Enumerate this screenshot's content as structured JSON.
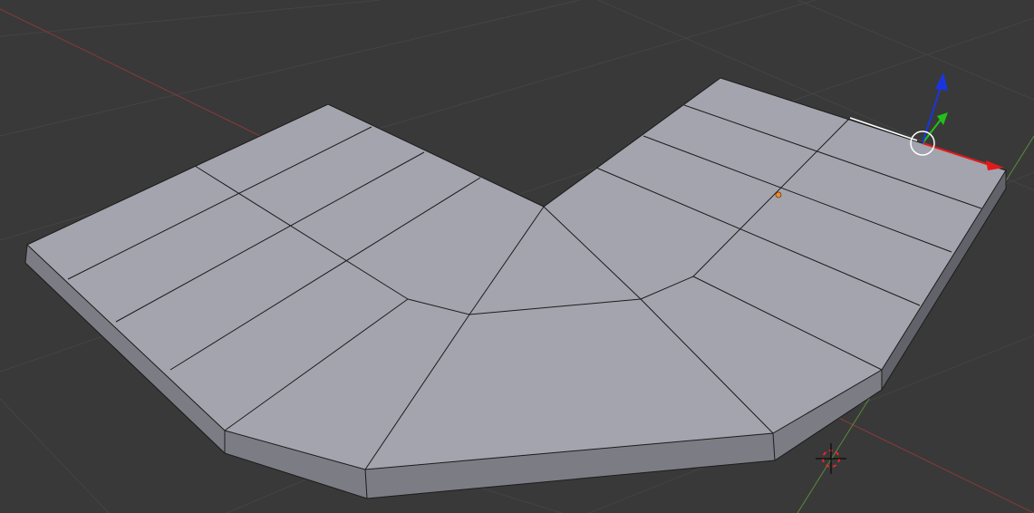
{
  "viewport": {
    "background": "#393939",
    "grid_color": "#444444",
    "x_axis_color": "#8a3a3a",
    "y_axis_color": "#5a8a3a"
  },
  "mesh": {
    "top_color": "#a4a4ae",
    "side_color": "#7c7c84",
    "side_dark_color": "#62626a",
    "edge_color": "#1c1c1c",
    "selected_edge_color": "#ffffff"
  },
  "manipulator": {
    "x_color": "#e21a1a",
    "y_color": "#22c01a",
    "z_color": "#1a35e0",
    "center_ring_color": "#ffffff"
  },
  "origin_color": "#f08c2a",
  "cursor": {
    "ring_color_a": "#e02a2a",
    "ring_color_b": "#ffffff",
    "cross_color": "#000000"
  }
}
